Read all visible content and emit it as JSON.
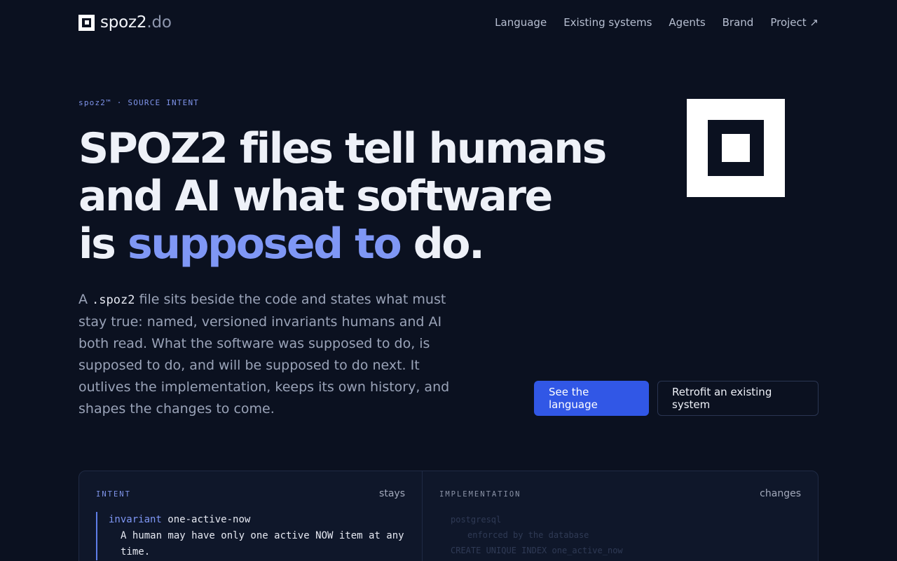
{
  "header": {
    "brand_name": "spoz2",
    "brand_tld": ".do",
    "nav": [
      "Language",
      "Existing systems",
      "Agents",
      "Brand",
      "Project ↗"
    ]
  },
  "hero": {
    "eyebrow": "spoz2™ · SOURCE INTENT",
    "headline_line1": "SPOZ2 files tell humans",
    "headline_line2": "and AI what software",
    "headline_line3_pre": "is ",
    "headline_line3_accent": "supposed to",
    "headline_line3_post": " do.",
    "lede_pre": "A ",
    "lede_code": ".spoz2",
    "lede_post": " file sits beside the code and states what must stay true: named, versioned invariants humans and AI both read. What the software was supposed to do, is supposed to do, and will be supposed to do next. It outlives the implementation, keeps its own history, and shapes the changes to come.",
    "primary_cta": "See the language",
    "secondary_cta": "Retrofit an existing system"
  },
  "panel": {
    "intent_label": "INTENT",
    "intent_note": "stays",
    "impl_label": "IMPLEMENTATION",
    "impl_note": "changes",
    "invariant_keyword": "invariant",
    "invariant_name": "one-active-now",
    "invariant_body_1": "A human may have only one active NOW item at any",
    "invariant_body_2": "time.",
    "impl_line_1": "postgresql",
    "impl_line_2": "enforced by the database",
    "impl_line_3": "CREATE UNIQUE INDEX one_active_now"
  },
  "colors": {
    "background": "#0b1120",
    "accent": "#7f97f5",
    "primary_button": "#3157e6"
  }
}
